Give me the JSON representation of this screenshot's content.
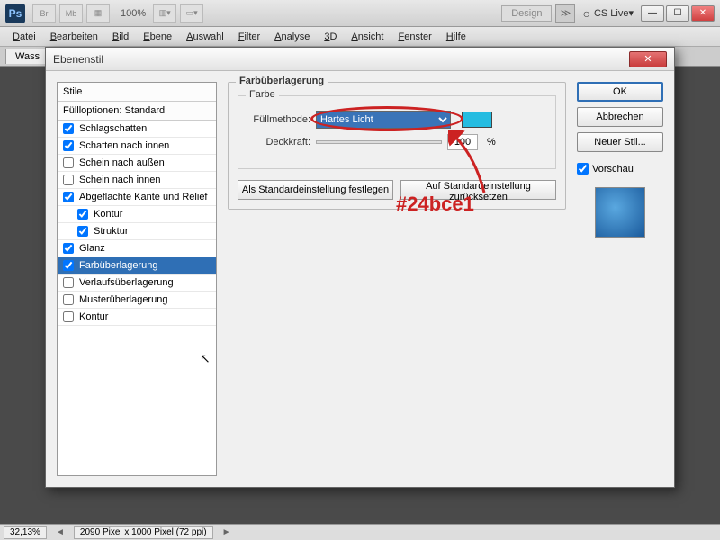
{
  "app": {
    "logo": "Ps",
    "toolbtns": [
      "Br",
      "Mb",
      "▦"
    ],
    "zoom": "100%",
    "design_label": "Design",
    "cslive": "CS Live"
  },
  "menu": [
    "Datei",
    "Bearbeiten",
    "Bild",
    "Ebene",
    "Auswahl",
    "Filter",
    "Analyse",
    "3D",
    "Ansicht",
    "Fenster",
    "Hilfe"
  ],
  "doc_tab": "Wass",
  "dialog": {
    "title": "Ebenenstil",
    "styles_header": "Stile",
    "fill_options": "Füllloptionen: Standard",
    "style_items": [
      {
        "label": "Schlagschatten",
        "checked": true,
        "indent": false
      },
      {
        "label": "Schatten nach innen",
        "checked": true,
        "indent": false
      },
      {
        "label": "Schein nach außen",
        "checked": false,
        "indent": false
      },
      {
        "label": "Schein nach innen",
        "checked": false,
        "indent": false
      },
      {
        "label": "Abgeflachte Kante und Relief",
        "checked": true,
        "indent": false
      },
      {
        "label": "Kontur",
        "checked": true,
        "indent": true
      },
      {
        "label": "Struktur",
        "checked": true,
        "indent": true
      },
      {
        "label": "Glanz",
        "checked": true,
        "indent": false
      },
      {
        "label": "Farbüberlagerung",
        "checked": true,
        "indent": false,
        "selected": true
      },
      {
        "label": "Verlaufsüberlagerung",
        "checked": false,
        "indent": false
      },
      {
        "label": "Musterüberlagerung",
        "checked": false,
        "indent": false
      },
      {
        "label": "Kontur",
        "checked": false,
        "indent": false
      }
    ],
    "group_title": "Farbüberlagerung",
    "inner_title": "Farbe",
    "blend_label": "Füllmethode:",
    "blend_value": "Hartes Licht",
    "swatch_color": "#24bce1",
    "opacity_label": "Deckkraft:",
    "opacity_value": "100",
    "opacity_unit": "%",
    "set_default": "Als Standardeinstellung festlegen",
    "reset_default": "Auf Standardeinstellung zurücksetzen",
    "ok": "OK",
    "cancel": "Abbrechen",
    "new_style": "Neuer Stil...",
    "preview_label": "Vorschau"
  },
  "annotation": "#24bce1",
  "status": {
    "zoom": "32,13%",
    "dims": "2090 Pixel x 1000 Pixel (72 ppi)"
  }
}
